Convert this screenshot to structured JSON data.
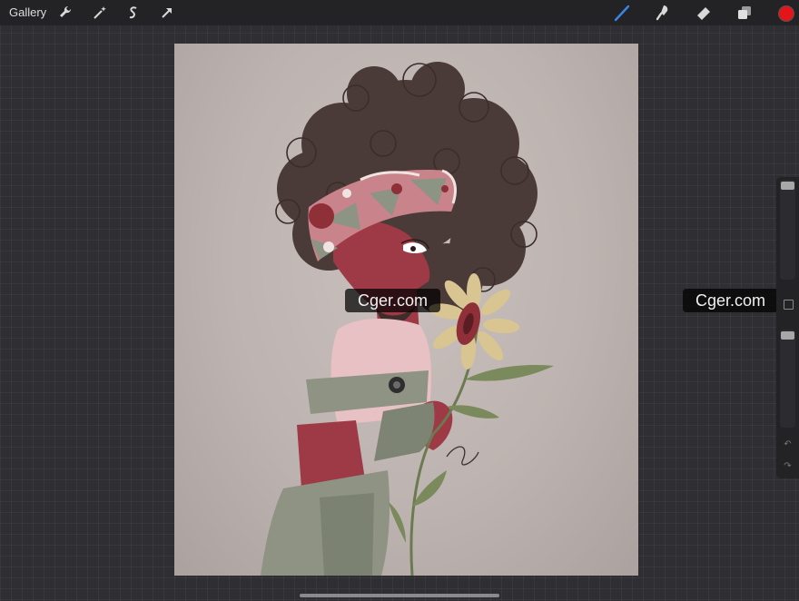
{
  "toolbar": {
    "gallery_label": "Gallery",
    "left_tools": [
      "wrench-icon",
      "magic-wand-icon",
      "selection-icon",
      "transform-arrow-icon"
    ],
    "right_tools": [
      "brush-icon",
      "smudge-icon",
      "eraser-icon",
      "layers-icon"
    ],
    "current_color": "#e3141a",
    "active_tool_color": "#3a86e8"
  },
  "sidebar": {
    "brush_size_level": 0.0,
    "opacity_level": 0.0
  },
  "watermarks": {
    "canvas_text": "Cger.com",
    "side_text": "Cger.com"
  }
}
